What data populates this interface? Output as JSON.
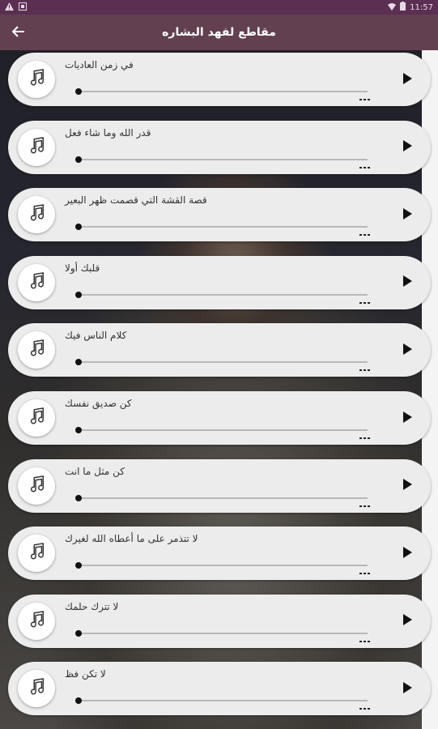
{
  "status_bar": {
    "time": "11:57",
    "left_icons": [
      "warning-icon",
      "notification-icon"
    ],
    "right_icons": [
      "wifi-icon",
      "battery-icon"
    ]
  },
  "toolbar": {
    "title": "مقاطع لفهد البشاره",
    "back_icon": "arrow-back-icon"
  },
  "colors": {
    "status_bar": "#5a2f52",
    "toolbar": "#62404f",
    "card": "#ececec"
  },
  "tracks": [
    {
      "title": "في زمن العاديات",
      "progress": 0
    },
    {
      "title": "قدر الله وما شاء فعل",
      "progress": 0
    },
    {
      "title": "قصة القشة التي قصمت ظهر البعير",
      "progress": 0
    },
    {
      "title": "قلبك أولا",
      "progress": 0
    },
    {
      "title": "كلام الناس فيك",
      "progress": 0
    },
    {
      "title": "كن صديق نفسك",
      "progress": 0
    },
    {
      "title": "كن مثل ما انت",
      "progress": 0
    },
    {
      "title": "لا تتذمر على ما أعطاه الله لغيرك",
      "progress": 0
    },
    {
      "title": "لا تترك حلمك",
      "progress": 0
    },
    {
      "title": "لا تكن فظ",
      "progress": 0
    }
  ]
}
